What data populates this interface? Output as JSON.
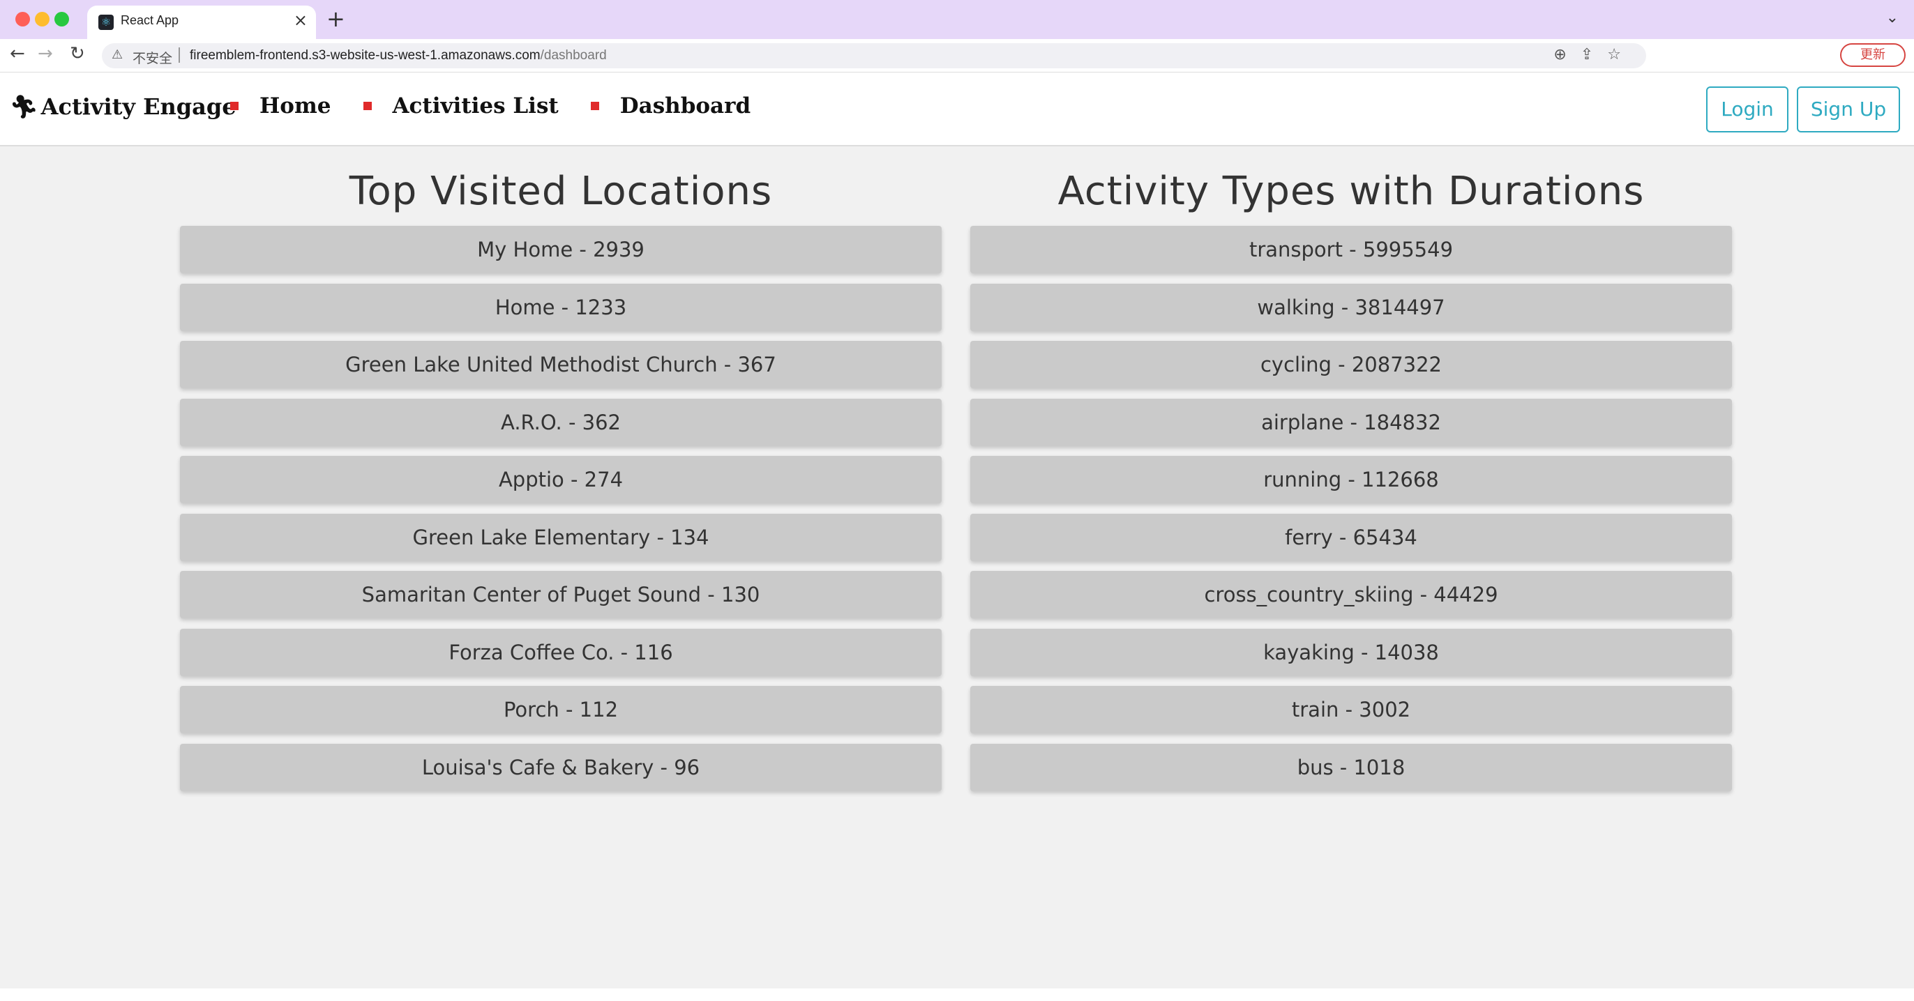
{
  "browser": {
    "tab_title": "React App",
    "tab_close": "×",
    "new_tab": "+",
    "insecure_label": "不安全",
    "url_host": "fireemblem-frontend.s3-website-us-west-1.amazonaws.com",
    "url_path": "/dashboard",
    "update_label": "更新"
  },
  "app": {
    "brand": "Activity Engage",
    "nav": [
      {
        "label": "Home"
      },
      {
        "label": "Activities List"
      },
      {
        "label": "Dashboard"
      }
    ],
    "login_label": "Login",
    "signup_label": "Sign Up"
  },
  "dashboard": {
    "locations": {
      "title": "Top Visited Locations",
      "items": [
        "My Home - 2939",
        "Home - 1233",
        "Green Lake United Methodist Church - 367",
        "A.R.O. - 362",
        "Apptio - 274",
        "Green Lake Elementary - 134",
        "Samaritan Center of Puget Sound - 130",
        "Forza Coffee Co. - 116",
        "Porch - 112",
        "Louisa's Cafe & Bakery - 96"
      ]
    },
    "activities": {
      "title": "Activity Types with Durations",
      "items": [
        "transport - 5995549",
        "walking - 3814497",
        "cycling - 2087322",
        "airplane - 184832",
        "running - 112668",
        "ferry - 65434",
        "cross_country_skiing - 44429",
        "kayaking - 14038",
        "train - 3002",
        "bus - 1018"
      ]
    }
  }
}
